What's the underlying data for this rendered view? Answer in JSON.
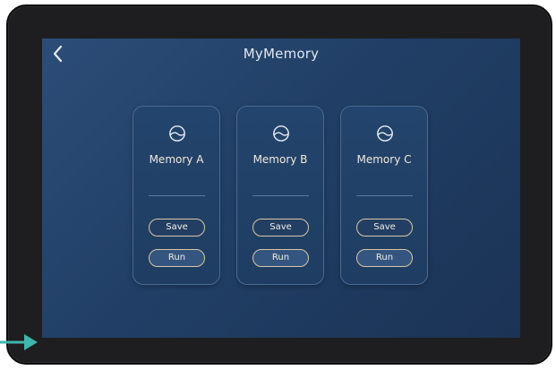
{
  "header": {
    "title": "MyMemory",
    "back_icon": "chevron-left-icon"
  },
  "cards": [
    {
      "title": "Memory A",
      "icon": "memory-wave-icon",
      "save_label": "Save",
      "run_label": "Run"
    },
    {
      "title": "Memory B",
      "icon": "memory-wave-icon",
      "save_label": "Save",
      "run_label": "Run"
    },
    {
      "title": "Memory C",
      "icon": "memory-wave-icon",
      "save_label": "Save",
      "run_label": "Run"
    }
  ],
  "colors": {
    "accent_border": "#d9c7a4",
    "screen_background": "#213f66",
    "pointer_arrow": "#3fb6ad"
  }
}
